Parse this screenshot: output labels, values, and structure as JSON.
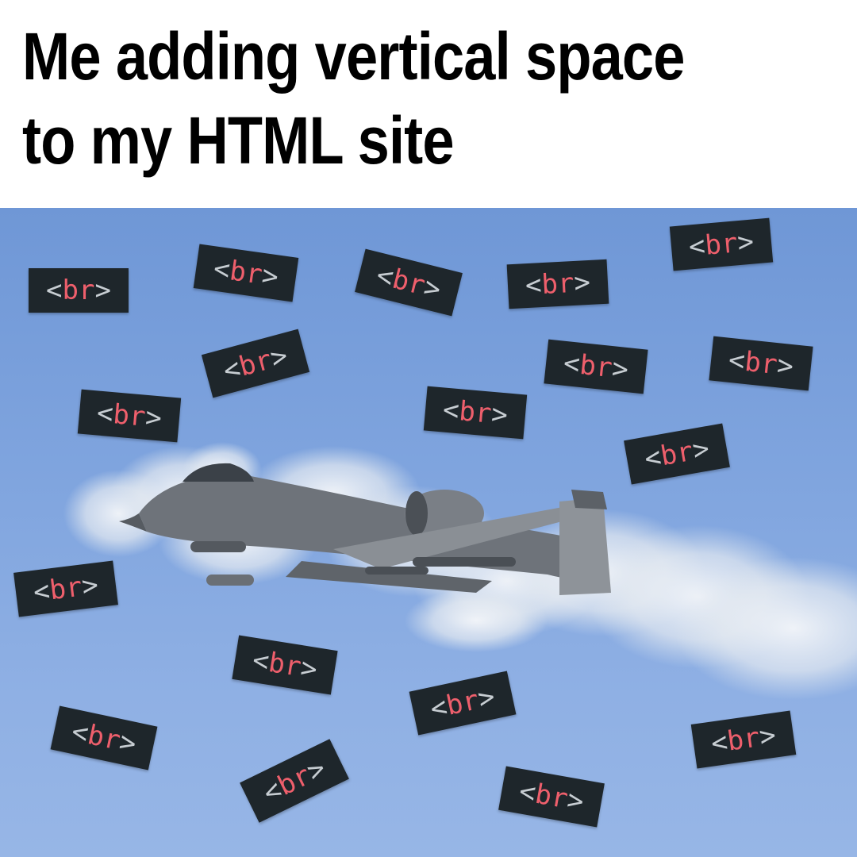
{
  "caption": {
    "line1": "Me adding vertical space",
    "line2": "to my HTML site"
  },
  "tag": {
    "open": "<",
    "word": "br",
    "close": ">"
  },
  "tags": [
    {
      "id": 1
    },
    {
      "id": 2
    },
    {
      "id": 3
    },
    {
      "id": 4
    },
    {
      "id": 5
    },
    {
      "id": 6
    },
    {
      "id": 7
    },
    {
      "id": 8
    },
    {
      "id": 9
    },
    {
      "id": 10
    },
    {
      "id": 11
    },
    {
      "id": 12
    },
    {
      "id": 13
    },
    {
      "id": 14
    },
    {
      "id": 15
    },
    {
      "id": 16
    },
    {
      "id": 17
    },
    {
      "id": 18
    },
    {
      "id": 19
    },
    {
      "id": 20
    }
  ],
  "colors": {
    "sky": "#7fa4de",
    "tag_bg": "#1e262b",
    "tag_word": "#ee5f6c",
    "tag_bracket": "#c7cdd2"
  },
  "icons": {
    "aircraft": "jet-aircraft-icon",
    "smoke": "gun-smoke-icon"
  }
}
